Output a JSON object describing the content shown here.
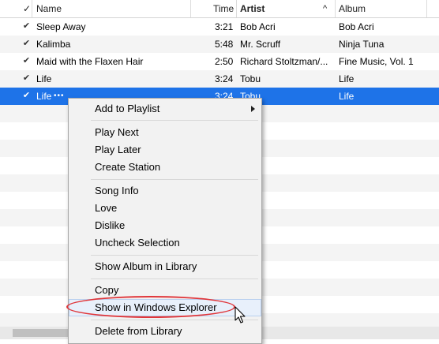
{
  "columns": {
    "check": "✓",
    "name": "Name",
    "time": "Time",
    "artist": "Artist",
    "artist_sort": "^",
    "album": "Album"
  },
  "rows": [
    {
      "name": "Sleep Away",
      "time": "3:21",
      "artist": "Bob Acri",
      "album": "Bob Acri",
      "checked": true
    },
    {
      "name": "Kalimba",
      "time": "5:48",
      "artist": "Mr. Scruff",
      "album": "Ninja Tuna",
      "checked": true
    },
    {
      "name": "Maid with the Flaxen Hair",
      "time": "2:50",
      "artist": "Richard Stoltzman/...",
      "album": "Fine Music, Vol. 1",
      "checked": true
    },
    {
      "name": "Life",
      "time": "3:24",
      "artist": "Tobu",
      "album": "Life",
      "checked": true
    },
    {
      "name": "Life",
      "name_more": "•••",
      "time": "3:24",
      "artist": "Tobu",
      "album": "Life",
      "checked": true,
      "selected": true
    }
  ],
  "context_menu": {
    "add_to_playlist": "Add to Playlist",
    "play_next": "Play Next",
    "play_later": "Play Later",
    "create_station": "Create Station",
    "song_info": "Song Info",
    "love": "Love",
    "dislike": "Dislike",
    "uncheck_selection": "Uncheck Selection",
    "show_album_in_library": "Show Album in Library",
    "copy": "Copy",
    "show_in_windows_explorer": "Show in Windows Explorer",
    "delete_from_library": "Delete from Library"
  },
  "colors": {
    "selection": "#1e73e8",
    "highlight_ellipse": "#e0363a"
  }
}
